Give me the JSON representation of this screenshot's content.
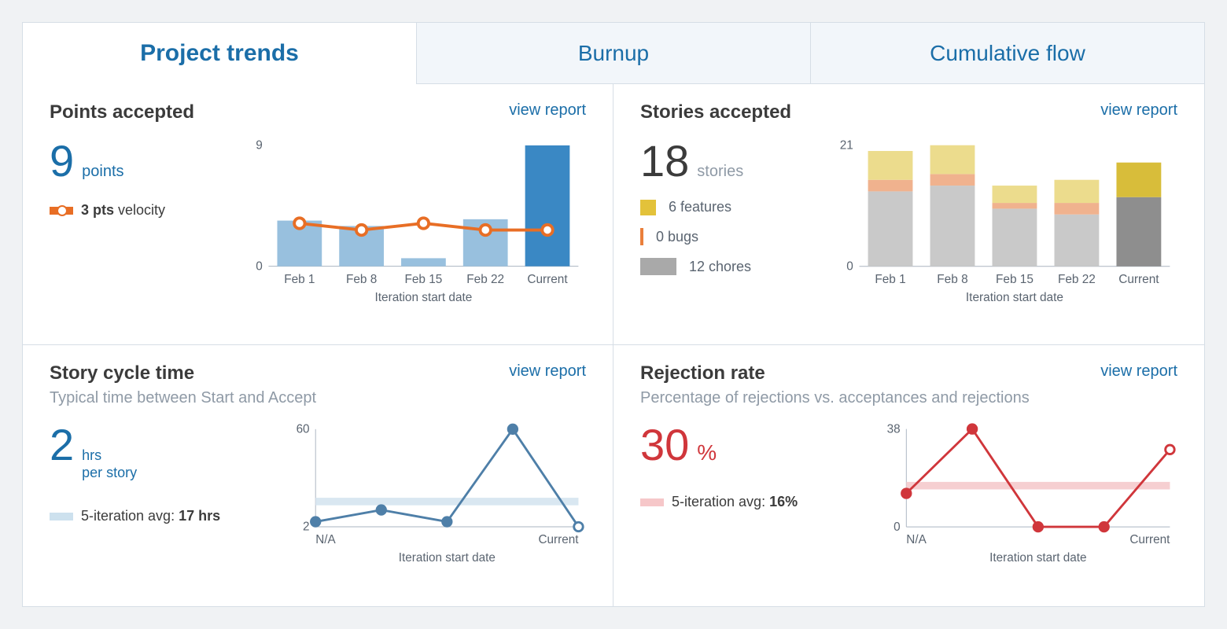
{
  "tabs": [
    {
      "label": "Project trends",
      "active": true
    },
    {
      "label": "Burnup",
      "active": false
    },
    {
      "label": "Cumulative flow",
      "active": false
    }
  ],
  "common": {
    "view_report": "view report",
    "x_axis_label": "Iteration start date"
  },
  "points_accepted": {
    "title": "Points accepted",
    "value": "9",
    "unit": "points",
    "velocity_label": "3 pts",
    "velocity_suffix": "velocity"
  },
  "stories_accepted": {
    "title": "Stories accepted",
    "value": "18",
    "unit": "stories",
    "features_label": "6 features",
    "bugs_label": "0 bugs",
    "chores_label": "12 chores"
  },
  "cycle_time": {
    "title": "Story cycle time",
    "subtitle": "Typical time between Start and Accept",
    "value": "2",
    "unit1": "hrs",
    "unit2": "per story",
    "avg_label": "5-iteration avg: ",
    "avg_value": "17 hrs"
  },
  "rejection": {
    "title": "Rejection rate",
    "subtitle": "Percentage of rejections vs. acceptances and rejections",
    "value": "30",
    "unit": "%",
    "avg_label": "5-iteration avg: ",
    "avg_value": "16%"
  },
  "chart_data": [
    {
      "id": "points_accepted",
      "type": "bar+line",
      "categories": [
        "Feb 1",
        "Feb 8",
        "Feb 15",
        "Feb 22",
        "Current"
      ],
      "series": [
        {
          "name": "points accepted",
          "type": "bar",
          "values": [
            3.4,
            3.0,
            0.6,
            3.5,
            9.0
          ],
          "color": "#98c0de",
          "current_color": "#3a88c4"
        },
        {
          "name": "velocity",
          "type": "line",
          "values": [
            3.2,
            2.7,
            3.2,
            2.7,
            2.7
          ],
          "color": "#e86e25"
        }
      ],
      "ylim": [
        0,
        9
      ],
      "yticks": [
        0,
        9
      ],
      "xlabel": "Iteration start date"
    },
    {
      "id": "stories_accepted",
      "type": "stacked-bar",
      "categories": [
        "Feb 1",
        "Feb 8",
        "Feb 15",
        "Feb 22",
        "Current"
      ],
      "series": [
        {
          "name": "chores",
          "values": [
            13,
            14,
            10,
            9,
            12
          ],
          "color": "#c9c9c9",
          "current_color": "#8e8e8e"
        },
        {
          "name": "bugs",
          "values": [
            2,
            2,
            1,
            2,
            0
          ],
          "color": "#f0b28e",
          "current_color": "#ea7f3b"
        },
        {
          "name": "features",
          "values": [
            5,
            5,
            3,
            4,
            6
          ],
          "color": "#ecdc8d",
          "current_color": "#d8bd3a"
        }
      ],
      "ylim": [
        0,
        21
      ],
      "yticks": [
        0,
        21
      ],
      "xlabel": "Iteration start date"
    },
    {
      "id": "cycle_time",
      "type": "line",
      "categories": [
        "N/A",
        "",
        "",
        "",
        "Current"
      ],
      "values": [
        5,
        12,
        5,
        60,
        2
      ],
      "avg_line": 17,
      "ylim": [
        2,
        60
      ],
      "yticks": [
        2,
        60
      ],
      "color": "#4e7fa8",
      "xlabel": "Iteration start date"
    },
    {
      "id": "rejection",
      "type": "line",
      "categories": [
        "N/A",
        "",
        "",
        "",
        "Current"
      ],
      "values": [
        13,
        38,
        0,
        0,
        30
      ],
      "avg_line": 16,
      "ylim": [
        0,
        38
      ],
      "yticks": [
        0,
        38
      ],
      "color": "#d0363b",
      "xlabel": "Iteration start date"
    }
  ]
}
